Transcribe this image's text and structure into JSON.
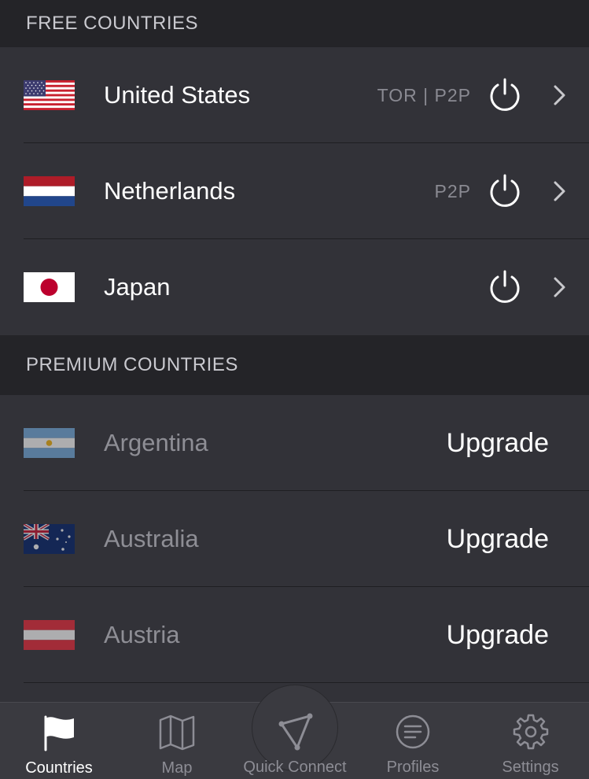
{
  "sections": {
    "free_title": "FREE COUNTRIES",
    "premium_title": "PREMIUM COUNTRIES"
  },
  "free_countries": [
    {
      "name": "United States",
      "tags": "TOR | P2P",
      "flag": "us-flag"
    },
    {
      "name": "Netherlands",
      "tags": "P2P",
      "flag": "nl-flag"
    },
    {
      "name": "Japan",
      "tags": "",
      "flag": "jp-flag"
    }
  ],
  "premium_countries": [
    {
      "name": "Argentina",
      "action": "Upgrade",
      "flag": "ar-flag"
    },
    {
      "name": "Australia",
      "action": "Upgrade",
      "flag": "au-flag"
    },
    {
      "name": "Austria",
      "action": "Upgrade",
      "flag": "at-flag"
    }
  ],
  "tabs": [
    {
      "label": "Countries",
      "icon": "flag-icon",
      "active": true
    },
    {
      "label": "Map",
      "icon": "map-icon",
      "active": false
    },
    {
      "label": "Quick Connect",
      "icon": "quick-connect-icon",
      "active": false
    },
    {
      "label": "Profiles",
      "icon": "profiles-icon",
      "active": false
    },
    {
      "label": "Settings",
      "icon": "gear-icon",
      "active": false
    }
  ],
  "colors": {
    "background": "#2c2c31",
    "header_bg": "#242428",
    "row_bg": "#323238",
    "tabbar_bg": "#3a3a40",
    "muted_text": "#8e8e95"
  }
}
